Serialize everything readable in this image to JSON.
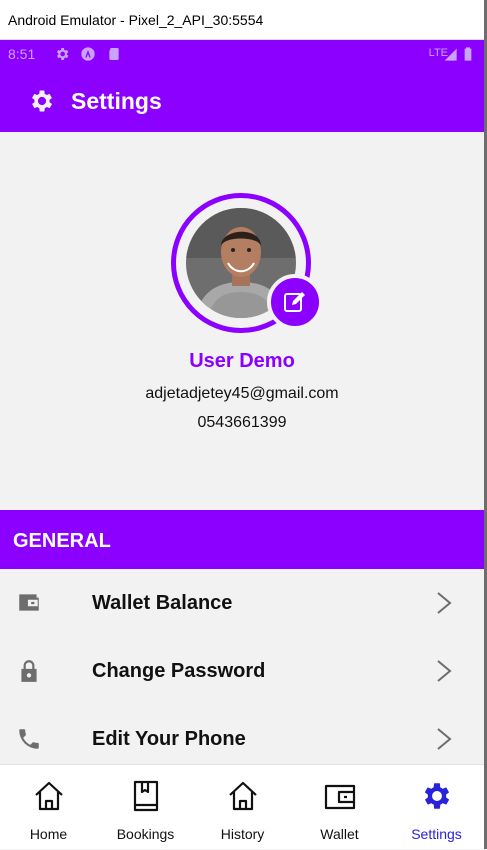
{
  "window": {
    "title": "Android Emulator - Pixel_2_API_30:5554"
  },
  "status_bar": {
    "time": "8:51",
    "network": "LTE"
  },
  "app_bar": {
    "title": "Settings",
    "icon": "gear-icon"
  },
  "profile": {
    "name": "User Demo",
    "email": "adjetadjetey45@gmail.com",
    "phone": "0543661399",
    "edit_icon": "edit-icon"
  },
  "general": {
    "header": "GENERAL",
    "items": [
      {
        "label": "Wallet Balance",
        "icon": "wallet-icon"
      },
      {
        "label": "Change Password",
        "icon": "lock-icon"
      },
      {
        "label": "Edit Your Phone",
        "icon": "phone-icon"
      }
    ]
  },
  "bottom_nav": {
    "items": [
      {
        "label": "Home",
        "icon": "home-icon"
      },
      {
        "label": "Bookings",
        "icon": "book-icon"
      },
      {
        "label": "History",
        "icon": "home-icon"
      },
      {
        "label": "Wallet",
        "icon": "wallet-icon"
      },
      {
        "label": "Settings",
        "icon": "gear-icon"
      }
    ],
    "active": "Settings"
  },
  "colors": {
    "primary": "#8b00ff",
    "active_nav": "#2a22d8",
    "background": "#f2f2f2"
  }
}
